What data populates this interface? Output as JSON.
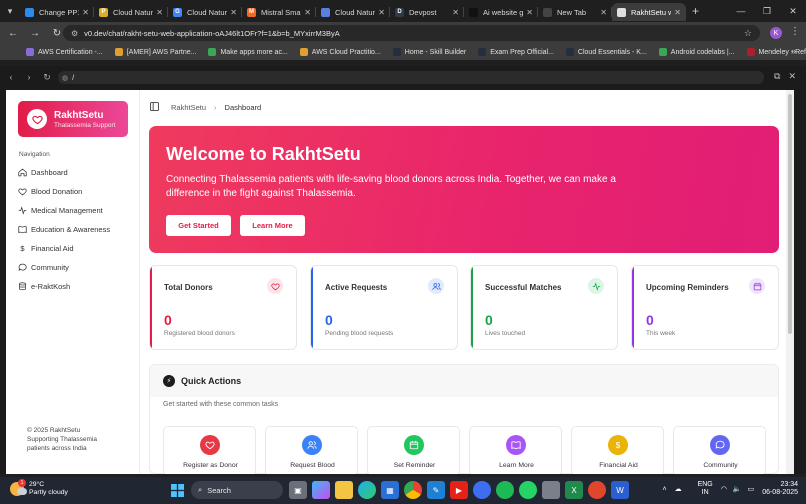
{
  "browser": {
    "tabs": [
      {
        "title": "Change PP1",
        "color": "#2b8be8",
        "glyph": "",
        "active": false
      },
      {
        "title": "Cloud Natura",
        "color": "#d9ae2a",
        "glyph": "PPT",
        "active": false
      },
      {
        "title": "Cloud Natura",
        "color": "#4285f4",
        "glyph": "G",
        "active": false
      },
      {
        "title": "Mistral Small",
        "color": "#f06a26",
        "glyph": "M",
        "active": false
      },
      {
        "title": "Cloud Natura",
        "color": "#5b7fe0",
        "glyph": "",
        "active": false
      },
      {
        "title": "Devpost",
        "color": "#2f3a44",
        "glyph": "D",
        "active": false
      },
      {
        "title": "Ai website g",
        "color": "#111111",
        "glyph": "",
        "active": false
      },
      {
        "title": "New Tab",
        "color": "#444444",
        "glyph": "",
        "active": false
      },
      {
        "title": "RakhtSetu w",
        "color": "#e0e0e0",
        "glyph": "",
        "active": true
      }
    ],
    "url": "v0.dev/chat/rakht-setu-web-application-oAJ46lt1OFr?f=1&b=b_MYxirrM3ByA",
    "profile_initial": "K",
    "bookmarks": [
      {
        "label": "AWS Certification -...",
        "color": "#8a6cd8"
      },
      {
        "label": "[AMER] AWS Partne...",
        "color": "#e0a030"
      },
      {
        "label": "Make apps more ac...",
        "color": "#3aa757"
      },
      {
        "label": "AWS Cloud Practitio...",
        "color": "#e0a030"
      },
      {
        "label": "Home - Skill Builder",
        "color": "#232f3e"
      },
      {
        "label": "Exam Prep Official...",
        "color": "#232f3e"
      },
      {
        "label": "Cloud Essentials - K...",
        "color": "#232f3e"
      },
      {
        "label": "Android codelabs |...",
        "color": "#3aa757"
      },
      {
        "label": "Mendeley - Referen...",
        "color": "#b01e2e"
      }
    ],
    "preview_path": "/"
  },
  "app": {
    "brand_name": "RakhtSetu",
    "brand_tagline": "Thalassemia Support",
    "nav_heading": "Navigation",
    "nav_items": [
      {
        "label": "Dashboard",
        "icon": "home-icon"
      },
      {
        "label": "Blood Donation",
        "icon": "heart-icon"
      },
      {
        "label": "Medical Management",
        "icon": "activity-icon"
      },
      {
        "label": "Education & Awareness",
        "icon": "book-icon"
      },
      {
        "label": "Financial Aid",
        "icon": "dollar-icon"
      },
      {
        "label": "Community",
        "icon": "chat-icon"
      },
      {
        "label": "e-RaktKosh",
        "icon": "database-icon"
      }
    ],
    "footer_line1": "© 2025 RakhtSetu",
    "footer_line2": "Supporting Thalassemia",
    "footer_line3": "patients across India",
    "breadcrumb_root": "RakhtSetu",
    "breadcrumb_current": "Dashboard",
    "hero": {
      "title": "Welcome to RakhtSetu",
      "text": "Connecting Thalassemia patients with life-saving blood donors across India. Together, we can make a difference in the fight against Thalassemia.",
      "primary_button": "Get Started",
      "secondary_button": "Learn More"
    },
    "stats": [
      {
        "title": "Total Donors",
        "value": "0",
        "sub": "Registered blood donors",
        "accent": "#e11d48",
        "badge_bg": "#fde4e8",
        "icon": "heart-icon"
      },
      {
        "title": "Active Requests",
        "value": "0",
        "sub": "Pending blood requests",
        "accent": "#2563eb",
        "badge_bg": "#e1eafd",
        "icon": "users-icon"
      },
      {
        "title": "Successful Matches",
        "value": "0",
        "sub": "Lives touched",
        "accent": "#16a34a",
        "badge_bg": "#dcf5e4",
        "icon": "activity-icon"
      },
      {
        "title": "Upcoming Reminders",
        "value": "0",
        "sub": "This week",
        "accent": "#9333ea",
        "badge_bg": "#f1e3fb",
        "icon": "calendar-icon"
      }
    ],
    "quick_actions": {
      "title": "Quick Actions",
      "subtitle": "Get started with these common tasks",
      "items": [
        {
          "label": "Register as Donor",
          "color": "#e53945"
        },
        {
          "label": "Request Blood",
          "color": "#3b82f6"
        },
        {
          "label": "Set Reminder",
          "color": "#22c55e"
        },
        {
          "label": "Learn More",
          "color": "#a855f7"
        },
        {
          "label": "Financial Aid",
          "color": "#eab308"
        },
        {
          "label": "Community",
          "color": "#6366f1"
        }
      ]
    }
  },
  "taskbar": {
    "temperature": "29°C",
    "weather": "Partly cloudy",
    "weather_badge": "1",
    "search_label": "Search",
    "lang_line1": "ENG",
    "lang_line2": "IN",
    "time": "23:34",
    "date": "06-08-2025"
  }
}
